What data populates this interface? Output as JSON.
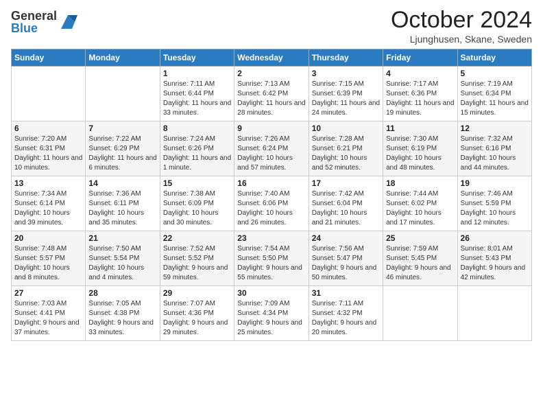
{
  "header": {
    "logo_general": "General",
    "logo_blue": "Blue",
    "month_title": "October 2024",
    "location": "Ljunghusen, Skane, Sweden"
  },
  "days_of_week": [
    "Sunday",
    "Monday",
    "Tuesday",
    "Wednesday",
    "Thursday",
    "Friday",
    "Saturday"
  ],
  "weeks": [
    [
      {
        "day": null,
        "sunrise": null,
        "sunset": null,
        "daylight": null
      },
      {
        "day": null,
        "sunrise": null,
        "sunset": null,
        "daylight": null
      },
      {
        "day": "1",
        "sunrise": "Sunrise: 7:11 AM",
        "sunset": "Sunset: 6:44 PM",
        "daylight": "Daylight: 11 hours and 33 minutes."
      },
      {
        "day": "2",
        "sunrise": "Sunrise: 7:13 AM",
        "sunset": "Sunset: 6:42 PM",
        "daylight": "Daylight: 11 hours and 28 minutes."
      },
      {
        "day": "3",
        "sunrise": "Sunrise: 7:15 AM",
        "sunset": "Sunset: 6:39 PM",
        "daylight": "Daylight: 11 hours and 24 minutes."
      },
      {
        "day": "4",
        "sunrise": "Sunrise: 7:17 AM",
        "sunset": "Sunset: 6:36 PM",
        "daylight": "Daylight: 11 hours and 19 minutes."
      },
      {
        "day": "5",
        "sunrise": "Sunrise: 7:19 AM",
        "sunset": "Sunset: 6:34 PM",
        "daylight": "Daylight: 11 hours and 15 minutes."
      }
    ],
    [
      {
        "day": "6",
        "sunrise": "Sunrise: 7:20 AM",
        "sunset": "Sunset: 6:31 PM",
        "daylight": "Daylight: 11 hours and 10 minutes."
      },
      {
        "day": "7",
        "sunrise": "Sunrise: 7:22 AM",
        "sunset": "Sunset: 6:29 PM",
        "daylight": "Daylight: 11 hours and 6 minutes."
      },
      {
        "day": "8",
        "sunrise": "Sunrise: 7:24 AM",
        "sunset": "Sunset: 6:26 PM",
        "daylight": "Daylight: 11 hours and 1 minute."
      },
      {
        "day": "9",
        "sunrise": "Sunrise: 7:26 AM",
        "sunset": "Sunset: 6:24 PM",
        "daylight": "Daylight: 10 hours and 57 minutes."
      },
      {
        "day": "10",
        "sunrise": "Sunrise: 7:28 AM",
        "sunset": "Sunset: 6:21 PM",
        "daylight": "Daylight: 10 hours and 52 minutes."
      },
      {
        "day": "11",
        "sunrise": "Sunrise: 7:30 AM",
        "sunset": "Sunset: 6:19 PM",
        "daylight": "Daylight: 10 hours and 48 minutes."
      },
      {
        "day": "12",
        "sunrise": "Sunrise: 7:32 AM",
        "sunset": "Sunset: 6:16 PM",
        "daylight": "Daylight: 10 hours and 44 minutes."
      }
    ],
    [
      {
        "day": "13",
        "sunrise": "Sunrise: 7:34 AM",
        "sunset": "Sunset: 6:14 PM",
        "daylight": "Daylight: 10 hours and 39 minutes."
      },
      {
        "day": "14",
        "sunrise": "Sunrise: 7:36 AM",
        "sunset": "Sunset: 6:11 PM",
        "daylight": "Daylight: 10 hours and 35 minutes."
      },
      {
        "day": "15",
        "sunrise": "Sunrise: 7:38 AM",
        "sunset": "Sunset: 6:09 PM",
        "daylight": "Daylight: 10 hours and 30 minutes."
      },
      {
        "day": "16",
        "sunrise": "Sunrise: 7:40 AM",
        "sunset": "Sunset: 6:06 PM",
        "daylight": "Daylight: 10 hours and 26 minutes."
      },
      {
        "day": "17",
        "sunrise": "Sunrise: 7:42 AM",
        "sunset": "Sunset: 6:04 PM",
        "daylight": "Daylight: 10 hours and 21 minutes."
      },
      {
        "day": "18",
        "sunrise": "Sunrise: 7:44 AM",
        "sunset": "Sunset: 6:02 PM",
        "daylight": "Daylight: 10 hours and 17 minutes."
      },
      {
        "day": "19",
        "sunrise": "Sunrise: 7:46 AM",
        "sunset": "Sunset: 5:59 PM",
        "daylight": "Daylight: 10 hours and 12 minutes."
      }
    ],
    [
      {
        "day": "20",
        "sunrise": "Sunrise: 7:48 AM",
        "sunset": "Sunset: 5:57 PM",
        "daylight": "Daylight: 10 hours and 8 minutes."
      },
      {
        "day": "21",
        "sunrise": "Sunrise: 7:50 AM",
        "sunset": "Sunset: 5:54 PM",
        "daylight": "Daylight: 10 hours and 4 minutes."
      },
      {
        "day": "22",
        "sunrise": "Sunrise: 7:52 AM",
        "sunset": "Sunset: 5:52 PM",
        "daylight": "Daylight: 9 hours and 59 minutes."
      },
      {
        "day": "23",
        "sunrise": "Sunrise: 7:54 AM",
        "sunset": "Sunset: 5:50 PM",
        "daylight": "Daylight: 9 hours and 55 minutes."
      },
      {
        "day": "24",
        "sunrise": "Sunrise: 7:56 AM",
        "sunset": "Sunset: 5:47 PM",
        "daylight": "Daylight: 9 hours and 50 minutes."
      },
      {
        "day": "25",
        "sunrise": "Sunrise: 7:59 AM",
        "sunset": "Sunset: 5:45 PM",
        "daylight": "Daylight: 9 hours and 46 minutes."
      },
      {
        "day": "26",
        "sunrise": "Sunrise: 8:01 AM",
        "sunset": "Sunset: 5:43 PM",
        "daylight": "Daylight: 9 hours and 42 minutes."
      }
    ],
    [
      {
        "day": "27",
        "sunrise": "Sunrise: 7:03 AM",
        "sunset": "Sunset: 4:41 PM",
        "daylight": "Daylight: 9 hours and 37 minutes."
      },
      {
        "day": "28",
        "sunrise": "Sunrise: 7:05 AM",
        "sunset": "Sunset: 4:38 PM",
        "daylight": "Daylight: 9 hours and 33 minutes."
      },
      {
        "day": "29",
        "sunrise": "Sunrise: 7:07 AM",
        "sunset": "Sunset: 4:36 PM",
        "daylight": "Daylight: 9 hours and 29 minutes."
      },
      {
        "day": "30",
        "sunrise": "Sunrise: 7:09 AM",
        "sunset": "Sunset: 4:34 PM",
        "daylight": "Daylight: 9 hours and 25 minutes."
      },
      {
        "day": "31",
        "sunrise": "Sunrise: 7:11 AM",
        "sunset": "Sunset: 4:32 PM",
        "daylight": "Daylight: 9 hours and 20 minutes."
      },
      {
        "day": null,
        "sunrise": null,
        "sunset": null,
        "daylight": null
      },
      {
        "day": null,
        "sunrise": null,
        "sunset": null,
        "daylight": null
      }
    ]
  ]
}
